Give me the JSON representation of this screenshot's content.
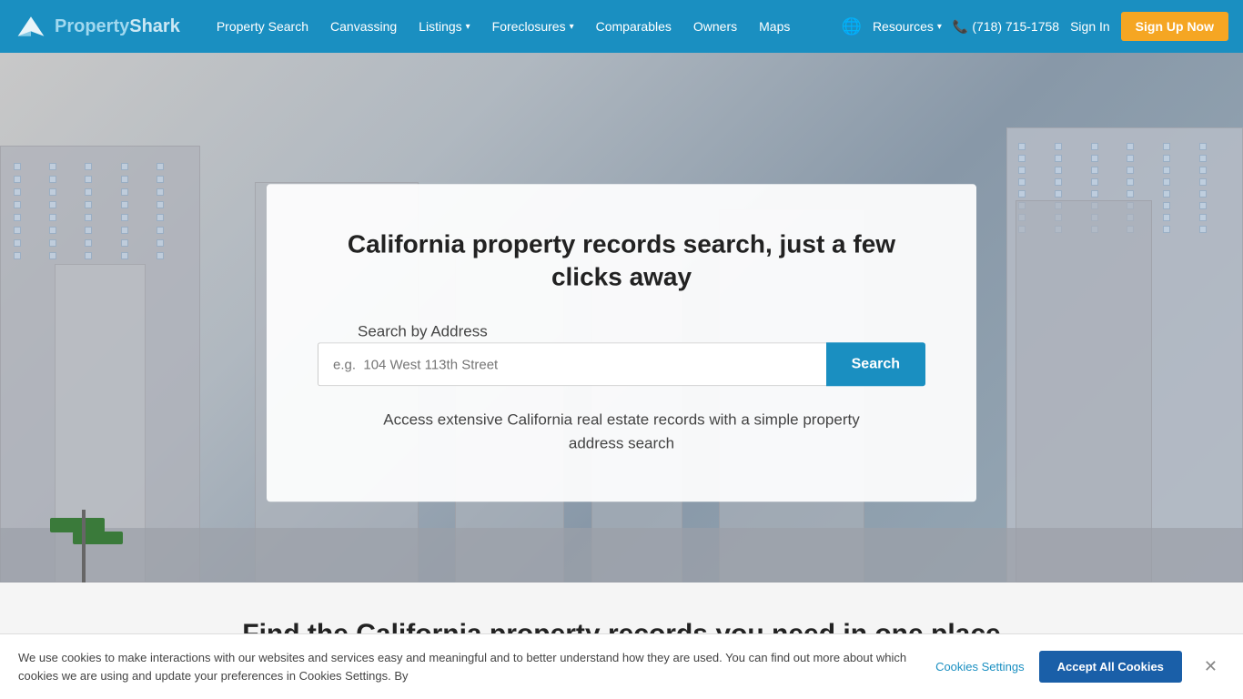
{
  "brand": {
    "name_part1": "Property",
    "name_part2": "Shark",
    "logo_alt": "PropertyShark logo"
  },
  "nav": {
    "links": [
      {
        "label": "Property Search",
        "has_dropdown": false
      },
      {
        "label": "Canvassing",
        "has_dropdown": false
      },
      {
        "label": "Listings",
        "has_dropdown": true
      },
      {
        "label": "Foreclosures",
        "has_dropdown": true
      },
      {
        "label": "Comparables",
        "has_dropdown": false
      },
      {
        "label": "Owners",
        "has_dropdown": false
      },
      {
        "label": "Maps",
        "has_dropdown": false
      }
    ],
    "resources_label": "Resources",
    "phone": "(718) 715-1758",
    "signin_label": "Sign In",
    "signup_label": "Sign Up Now"
  },
  "hero": {
    "heading": "California property records search, just a few clicks away",
    "search_label": "Search by Address",
    "search_placeholder": "e.g.  104 West 113th Street",
    "search_button": "Search",
    "subtext": "Access extensive California real estate records with a simple property address search"
  },
  "below_hero": {
    "heading": "Find the California property records you need in one place"
  },
  "cookie": {
    "text": "We use cookies to make interactions with our websites and services easy and meaningful and to better understand how they are used. You can find out more about which cookies we are using and update your preferences in Cookies Settings. By",
    "settings_label": "Cookies Settings",
    "accept_label": "Accept All Cookies"
  }
}
